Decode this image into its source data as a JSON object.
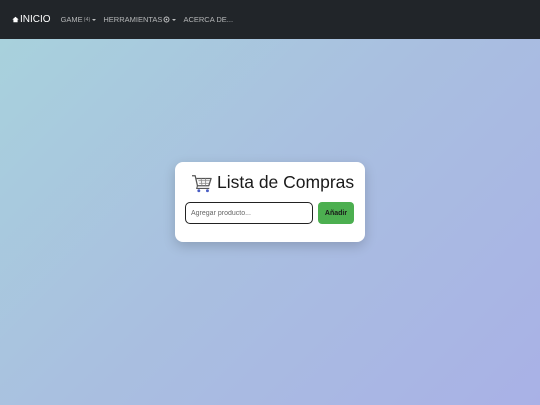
{
  "navbar": {
    "brand_label": "INICIO",
    "items": [
      {
        "label": "GAME",
        "sub": "(4)",
        "has_caret": true
      },
      {
        "label": "HERRAMIENTAS",
        "icon": "tools-icon",
        "has_caret": true
      },
      {
        "label": "ACERCA DE..."
      }
    ]
  },
  "card": {
    "icon": "shopping-cart-icon",
    "title": "Lista de Compras",
    "input": {
      "value": "",
      "placeholder": "Agregar producto..."
    },
    "add_button_label": "Añadir"
  },
  "colors": {
    "navbar_bg": "#212529",
    "background_start": "#a8d3dc",
    "background_end": "#a9b1e6",
    "button_green": "#4caf50"
  }
}
